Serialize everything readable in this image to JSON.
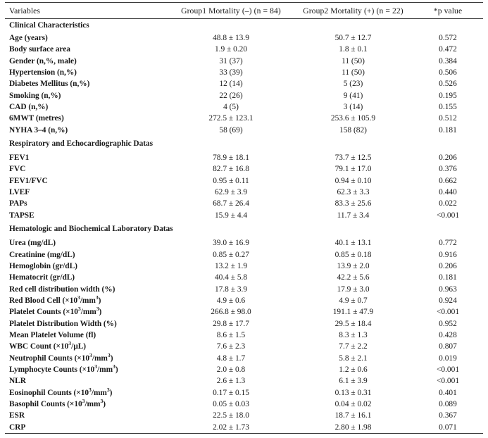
{
  "table": {
    "columns": [
      {
        "key": "variables",
        "label": "Variables",
        "align": "left"
      },
      {
        "key": "group1",
        "label": "Group1 Mortality (–) (n = 84)",
        "align": "center"
      },
      {
        "key": "group2",
        "label": "Group2 Mortality (+) (n = 22)",
        "align": "center"
      },
      {
        "key": "pvalue",
        "label": "*p value",
        "align": "center"
      }
    ],
    "sections": [
      {
        "title": "Clinical Characteristics",
        "rows": [
          {
            "label": "Age (years)",
            "group1": "48.8 ± 13.9",
            "group2": "50.7 ± 12.7",
            "pvalue": "0.572"
          },
          {
            "label": "Body surface area",
            "group1": "1.9 ± 0.20",
            "group2": "1.8 ± 0.1",
            "pvalue": "0.472"
          },
          {
            "label": "Gender (n,%, male)",
            "group1": "31 (37)",
            "group2": "11 (50)",
            "pvalue": "0.384"
          },
          {
            "label": "Hypertension (n,%)",
            "group1": "33 (39)",
            "group2": "11 (50)",
            "pvalue": "0.506"
          },
          {
            "label": "Diabetes Mellitus (n,%)",
            "group1": "12 (14)",
            "group2": "5 (23)",
            "pvalue": "0.526"
          },
          {
            "label": "Smoking (n,%)",
            "group1": "22 (26)",
            "group2": "9 (41)",
            "pvalue": "0.195"
          },
          {
            "label": "CAD (n,%)",
            "group1": "4 (5)",
            "group2": "3 (14)",
            "pvalue": "0.155"
          },
          {
            "label": "6MWT (metres)",
            "group1": "272.5 ± 123.1",
            "group2": "253.6 ± 105.9",
            "pvalue": "0.512"
          },
          {
            "label": "NYHA 3–4 (n,%)",
            "group1": "58 (69)",
            "group2": "158 (82)",
            "pvalue": "0.181"
          }
        ]
      },
      {
        "title": "Respiratory and Echocardiographic Datas",
        "rows": [
          {
            "label": "FEV1",
            "group1": "78.9 ± 18.1",
            "group2": "73.7 ± 12.5",
            "pvalue": "0.206"
          },
          {
            "label": "FVC",
            "group1": "82.7 ± 16.8",
            "group2": "79.1 ± 17.0",
            "pvalue": "0.376"
          },
          {
            "label": "FEV1/FVC",
            "group1": "0.95 ± 0.11",
            "group2": "0.94 ± 0.10",
            "pvalue": "0.662"
          },
          {
            "label": "LVEF",
            "group1": "62.9 ± 3.9",
            "group2": "62.3 ± 3.3",
            "pvalue": "0.440"
          },
          {
            "label": "PAPs",
            "group1": "68.7 ± 26.4",
            "group2": "83.3 ± 25.6",
            "pvalue": "0.022"
          },
          {
            "label": "TAPSE",
            "group1": "15.9 ± 4.4",
            "group2": "11.7 ± 3.4",
            "pvalue": "<0.001"
          }
        ]
      },
      {
        "title": "Hematologic and Biochemical Laboratory Datas",
        "rows": [
          {
            "label": "Urea (mg/dL)",
            "group1": "39.0 ± 16.9",
            "group2": "40.1 ± 13.1",
            "pvalue": "0.772"
          },
          {
            "label": "Creatinine (mg/dL)",
            "group1": "0.85 ± 0.27",
            "group2": "0.85 ± 0.18",
            "pvalue": "0.916"
          },
          {
            "label": "Hemoglobin (gr/dL)",
            "group1": "13.2 ± 1.9",
            "group2": "13.9 ± 2.0",
            "pvalue": "0.206"
          },
          {
            "label": "Hematocrit (gr/dL)",
            "group1": "40.4 ± 5.8",
            "group2": "42.2 ± 5.6",
            "pvalue": "0.181"
          },
          {
            "label": "Red cell distribution width (%)",
            "group1": "17.8 ± 3.9",
            "group2": "17.9 ± 3.0",
            "pvalue": "0.963"
          },
          {
            "label": "Red Blood Cell (×10<sup>3</sup>/mm<sup>3</sup>)",
            "html": true,
            "group1": "4.9 ± 0.6",
            "group2": "4.9 ± 0.7",
            "pvalue": "0.924"
          },
          {
            "label": "Platelet Counts (×10<sup>3</sup>/mm<sup>3</sup>)",
            "html": true,
            "group1": "266.8 ± 98.0",
            "group2": "191.1 ± 47.9",
            "pvalue": "<0.001"
          },
          {
            "label": "Platelet Distribution Width (%)",
            "group1": "29.8 ± 17.7",
            "group2": "29.5 ± 18.4",
            "pvalue": "0.952"
          },
          {
            "label": "Mean Platelet Volume (fl)",
            "group1": "8.6 ± 1.5",
            "group2": "8.3 ± 1.3",
            "pvalue": "0.428"
          },
          {
            "label": "WBC Count (×10<sup>3</sup>/µL)",
            "html": true,
            "group1": "7.6 ± 2.3",
            "group2": "7.7 ± 2.2",
            "pvalue": "0.807"
          },
          {
            "label": "Neutrophil Counts (×10<sup>3</sup>/mm<sup>3</sup>)",
            "html": true,
            "group1": "4.8 ± 1.7",
            "group2": "5.8 ± 2.1",
            "pvalue": "0.019"
          },
          {
            "label": "Lymphocyte Counts (×10<sup>3</sup>/mm<sup>3</sup>)",
            "html": true,
            "group1": "2.0 ± 0.8",
            "group2": "1.2 ± 0.6",
            "pvalue": "<0.001"
          },
          {
            "label": "NLR",
            "group1": "2.6 ± 1.3",
            "group2": "6.1 ± 3.9",
            "pvalue": "<0.001"
          },
          {
            "label": "Eosinophil  Counts (×10<sup>3</sup>/mm<sup>3</sup>)",
            "html": true,
            "group1": "0.17 ± 0.15",
            "group2": "0.13 ± 0.31",
            "pvalue": "0.401"
          },
          {
            "label": "Basophil Counts (×10<sup>3</sup>/mm<sup>3</sup>)",
            "html": true,
            "group1": "0.05 ± 0.03",
            "group2": "0.04 ± 0.02",
            "pvalue": "0.089"
          },
          {
            "label": "ESR",
            "group1": "22.5 ± 18.0",
            "group2": "18.7 ± 16.1",
            "pvalue": "0.367"
          },
          {
            "label": "CRP",
            "group1": "2.02 ± 1.73",
            "group2": "2.80 ± 1.98",
            "pvalue": "0.071"
          }
        ]
      }
    ]
  }
}
